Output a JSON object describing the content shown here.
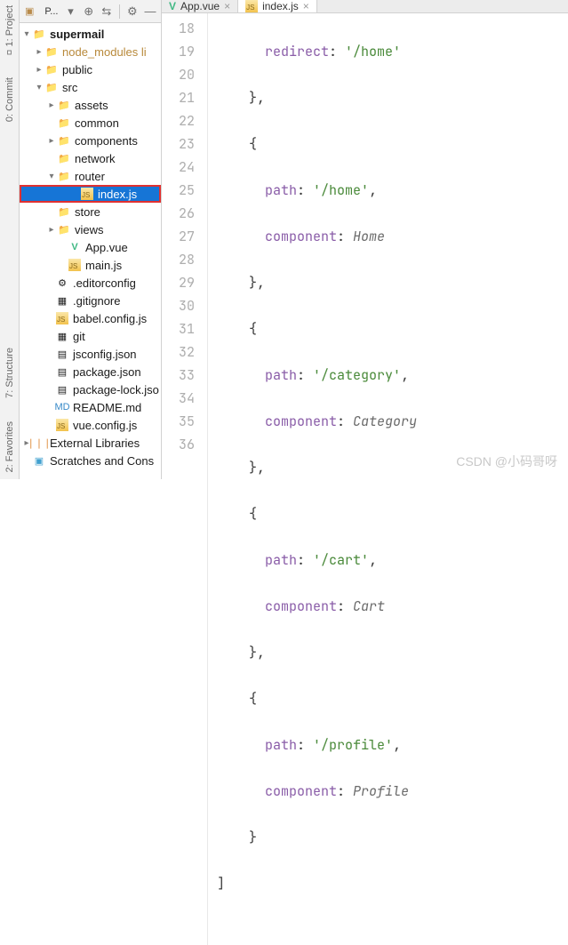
{
  "rail": {
    "project": "1: Project",
    "commit": "0: Commit",
    "structure": "7: Structure",
    "favorites": "2: Favorites"
  },
  "toolbar": {
    "label": "P..."
  },
  "tree": {
    "root": "supermail",
    "node_modules": "node_modules  li",
    "public": "public",
    "src": "src",
    "assets": "assets",
    "common": "common",
    "components": "components",
    "network": "network",
    "router": "router",
    "index_js": "index.js",
    "store": "store",
    "views": "views",
    "app_vue": "App.vue",
    "main_js": "main.js",
    "editorconfig": ".editorconfig",
    "gitignore": ".gitignore",
    "babel": "babel.config.js",
    "git": "git",
    "jsconfig": "jsconfig.json",
    "package": "package.json",
    "package_lock": "package-lock.jso",
    "readme": "README.md",
    "vueconfig": "vue.config.js",
    "ext_lib": "External Libraries",
    "scratches": "Scratches and Cons"
  },
  "tabs": {
    "app_vue": "App.vue",
    "index_js": "index.js"
  },
  "gutter": [
    "18",
    "19",
    "20",
    "21",
    "22",
    "23",
    "24",
    "25",
    "26",
    "27",
    "28",
    "29",
    "30",
    "31",
    "32",
    "33",
    "34",
    "35",
    "36"
  ],
  "code": {
    "redirect": "redirect",
    "home": "'/home'",
    "path": "path",
    "component": "component",
    "Home": "Home",
    "category": "'/category'",
    "Category": "Category",
    "cart": "'/cart'",
    "Cart": "Cart",
    "profile": "'/profile'",
    "Profile": "Profile"
  },
  "watermark": "CSDN @小码哥呀"
}
